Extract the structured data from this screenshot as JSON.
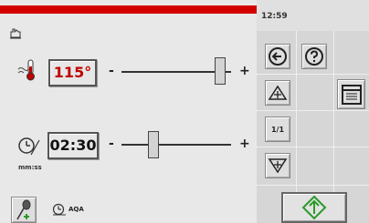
{
  "status": {
    "clock": "12:59"
  },
  "temperature": {
    "value": "115°",
    "minus_label": "-",
    "plus_label": "+",
    "level": 0.85
  },
  "timer": {
    "value": "02:30",
    "unit": "mm:ss",
    "minus_label": "-",
    "plus_label": "+",
    "level": 0.25
  },
  "bottom": {
    "mode_label": "AQA"
  },
  "sidebar": {
    "page_label": "1/1"
  },
  "colors": {
    "status_bar": "#d40000",
    "temp_text": "#c00000",
    "accent_green": "#2a9a2a"
  }
}
